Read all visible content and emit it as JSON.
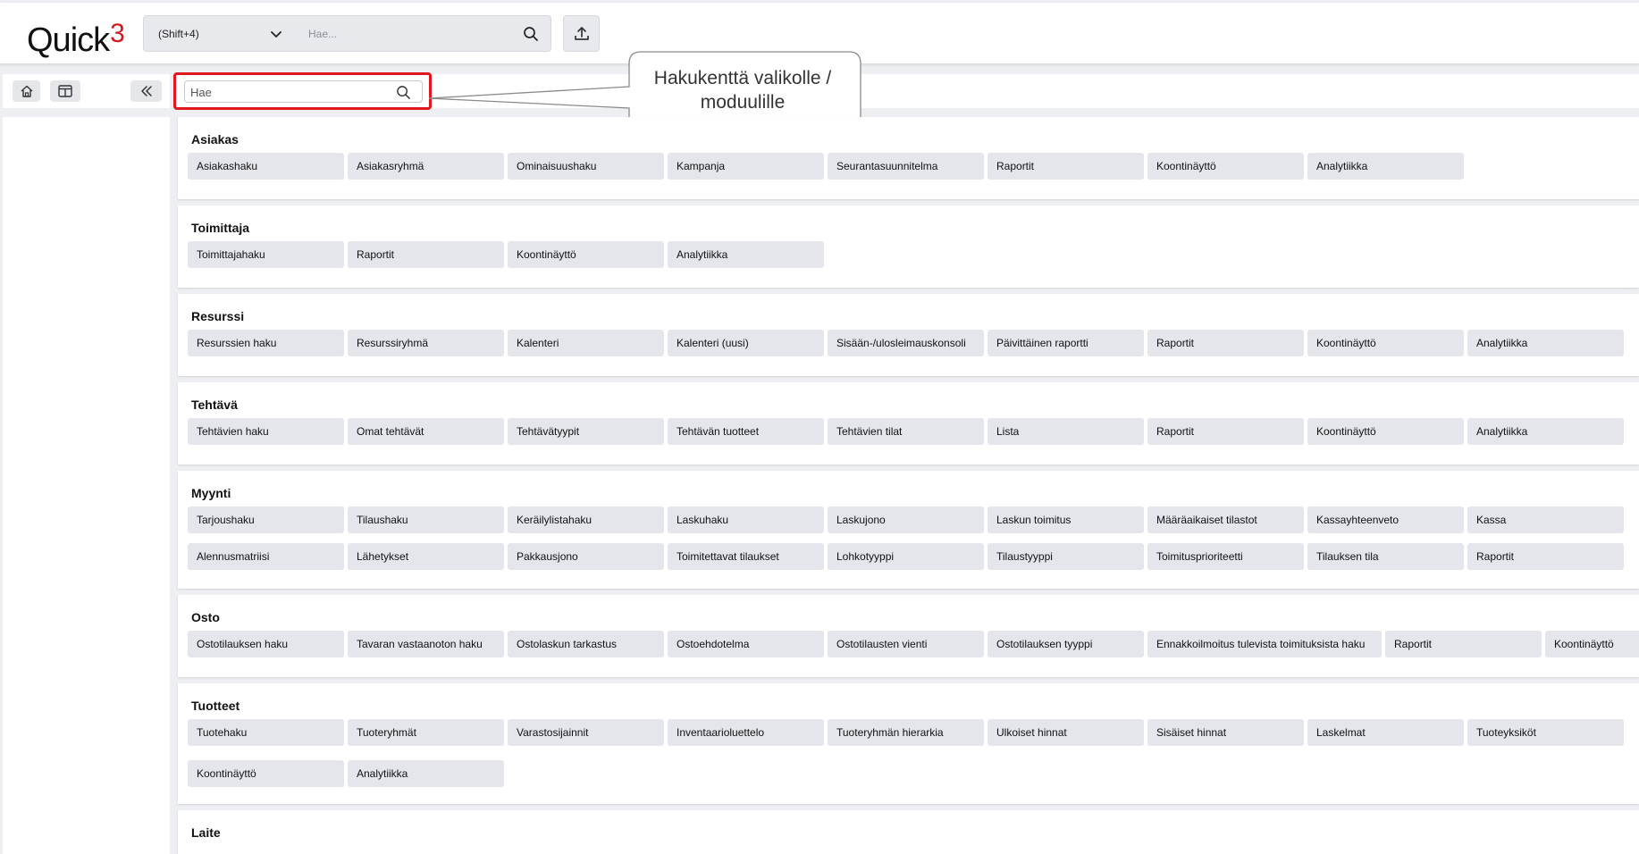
{
  "header": {
    "logo_text": "Quick",
    "logo_sup": "3",
    "shortcut_hint": "(Shift+4)",
    "search_placeholder": "Hae..."
  },
  "menu_search": {
    "placeholder": "Hae"
  },
  "callout": {
    "text": "Hakukenttä valikolle / moduulille"
  },
  "icons": {
    "chevron": "chevron-down-icon",
    "search": "search-icon",
    "upload": "upload-icon",
    "home": "home-icon",
    "layout": "layout-icon",
    "collapse": "double-chevron-left-icon"
  },
  "colors": {
    "accent": "#e2161e",
    "logo_sup": "#d11a1f",
    "button_bg": "#e4e6ec",
    "page_bg": "#eeeff2"
  },
  "sections": [
    {
      "title": "Asiakas",
      "rows": [
        [
          "Asiakashaku",
          "Asiakasryhmä",
          "Ominaisuushaku",
          "Kampanja",
          "Seurantasuunnitelma",
          "Raportit",
          "Koontinäyttö",
          "Analytiikka"
        ]
      ]
    },
    {
      "title": "Toimittaja",
      "rows": [
        [
          "Toimittajahaku",
          "Raportit",
          "Koontinäyttö",
          "Analytiikka"
        ]
      ]
    },
    {
      "title": "Resurssi",
      "rows": [
        [
          "Resurssien haku",
          "Resurssiryhmä",
          "Kalenteri",
          "Kalenteri (uusi)",
          "Sisään-/ulosleimauskonsoli",
          "Päivittäinen raportti",
          "Raportit",
          "Koontinäyttö",
          "Analytiikka"
        ]
      ]
    },
    {
      "title": "Tehtävä",
      "rows": [
        [
          "Tehtävien haku",
          "Omat tehtävät",
          "Tehtävätyypit",
          "Tehtävän tuotteet",
          "Tehtävien tilat",
          "Lista",
          "Raportit",
          "Koontinäyttö",
          "Analytiikka"
        ]
      ]
    },
    {
      "title": "Myynti",
      "rows": [
        [
          "Tarjoushaku",
          "Tilaushaku",
          "Keräilylistahaku",
          "Laskuhaku",
          "Laskujono",
          "Laskun toimitus",
          "Määräaikaiset tilastot",
          "Kassayhteenveto",
          "Kassa"
        ],
        [
          "Alennusmatriisi",
          "Lähetykset",
          "Pakkausjono",
          "Toimitettavat tilaukset",
          "Lohkotyyppi",
          "Tilaustyyppi",
          "Toimitusprioriteetti",
          "Tilauksen tila",
          "Raportit"
        ]
      ]
    },
    {
      "title": "Osto",
      "rows": [
        [
          "Ostotilauksen haku",
          "Tavaran vastaanoton haku",
          "Ostolaskun tarkastus",
          "Ostoehdotelma",
          "Ostotilausten vienti",
          "Ostotilauksen tyyppi",
          "Ennakkoilmoitus tulevista toimituksista haku",
          "Raportit",
          "Koontinäyttö"
        ]
      ]
    },
    {
      "title": "Tuotteet",
      "rows": [
        [
          "Tuotehaku",
          "Tuoteryhmät",
          "Varastosijainnit",
          "Inventaarioluettelo",
          "Tuoteryhmän hierarkia",
          "Ulkoiset hinnat",
          "Sisäiset hinnat",
          "Laskelmat",
          "Tuoteyksiköt"
        ],
        [
          "Koontinäyttö",
          "Analytiikka"
        ]
      ]
    },
    {
      "title": "Laite",
      "rows": []
    }
  ]
}
